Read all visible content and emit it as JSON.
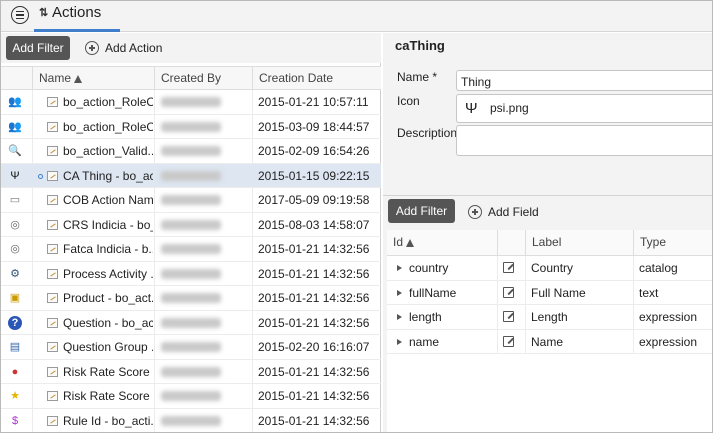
{
  "tab": {
    "title": "Actions"
  },
  "left_toolbar": {
    "add_filter": "Add Filter",
    "add_action": "Add Action"
  },
  "columns": {
    "name": "Name",
    "created_by": "Created By",
    "creation_date": "Creation Date"
  },
  "rows": [
    {
      "icon": "users-icon",
      "name": "bo_action_RoleO...",
      "date": "2015-01-21 10:57:11"
    },
    {
      "icon": "users-icon",
      "name": "bo_action_RoleO...",
      "date": "2015-03-09 18:44:57"
    },
    {
      "icon": "magnifier-icon",
      "name": "bo_action_Valid...",
      "date": "2015-02-09 16:54:26"
    },
    {
      "icon": "psi-icon",
      "name": "CA Thing - bo_ac...",
      "date": "2015-01-15 09:22:15",
      "selected": true
    },
    {
      "icon": "form-icon",
      "name": "COB Action Nam...",
      "date": "2017-05-09 09:19:58"
    },
    {
      "icon": "fingerprint-icon",
      "name": "CRS Indicia - bo_...",
      "date": "2015-08-03 14:58:07"
    },
    {
      "icon": "fingerprint-icon",
      "name": "Fatca Indicia - b...",
      "date": "2015-01-21 14:32:56"
    },
    {
      "icon": "activity-icon",
      "name": "Process Activity ...",
      "date": "2015-01-21 14:32:56"
    },
    {
      "icon": "product-icon",
      "name": "Product - bo_act...",
      "date": "2015-01-21 14:32:56"
    },
    {
      "icon": "question-icon",
      "name": "Question - bo_ac...",
      "date": "2015-01-21 14:32:56"
    },
    {
      "icon": "question-group-icon",
      "name": "Question Group ...",
      "date": "2015-02-20 16:16:07"
    },
    {
      "icon": "traffic-light-icon",
      "name": "Risk Rate Score ...",
      "date": "2015-01-21 14:32:56"
    },
    {
      "icon": "star-icon",
      "name": "Risk Rate Score ...",
      "date": "2015-01-21 14:32:56"
    },
    {
      "icon": "dollar-icon",
      "name": "Rule Id - bo_acti...",
      "date": "2015-01-21 14:32:56"
    }
  ],
  "detail": {
    "title": "caThing",
    "name_label": "Name *",
    "name_value": "Thing",
    "icon_label": "Icon",
    "icon_value": "psi.png",
    "description_label": "Description",
    "description_value": ""
  },
  "fields_toolbar": {
    "add_filter": "Add Filter",
    "add_field": "Add Field"
  },
  "field_columns": {
    "id": "Id",
    "label": "Label",
    "type": "Type"
  },
  "fields": [
    {
      "id": "country",
      "label": "Country",
      "type": "catalog"
    },
    {
      "id": "fullName",
      "label": "Full Name",
      "type": "text"
    },
    {
      "id": "length",
      "label": "Length",
      "type": "expression"
    },
    {
      "id": "name",
      "label": "Name",
      "type": "expression"
    }
  ]
}
